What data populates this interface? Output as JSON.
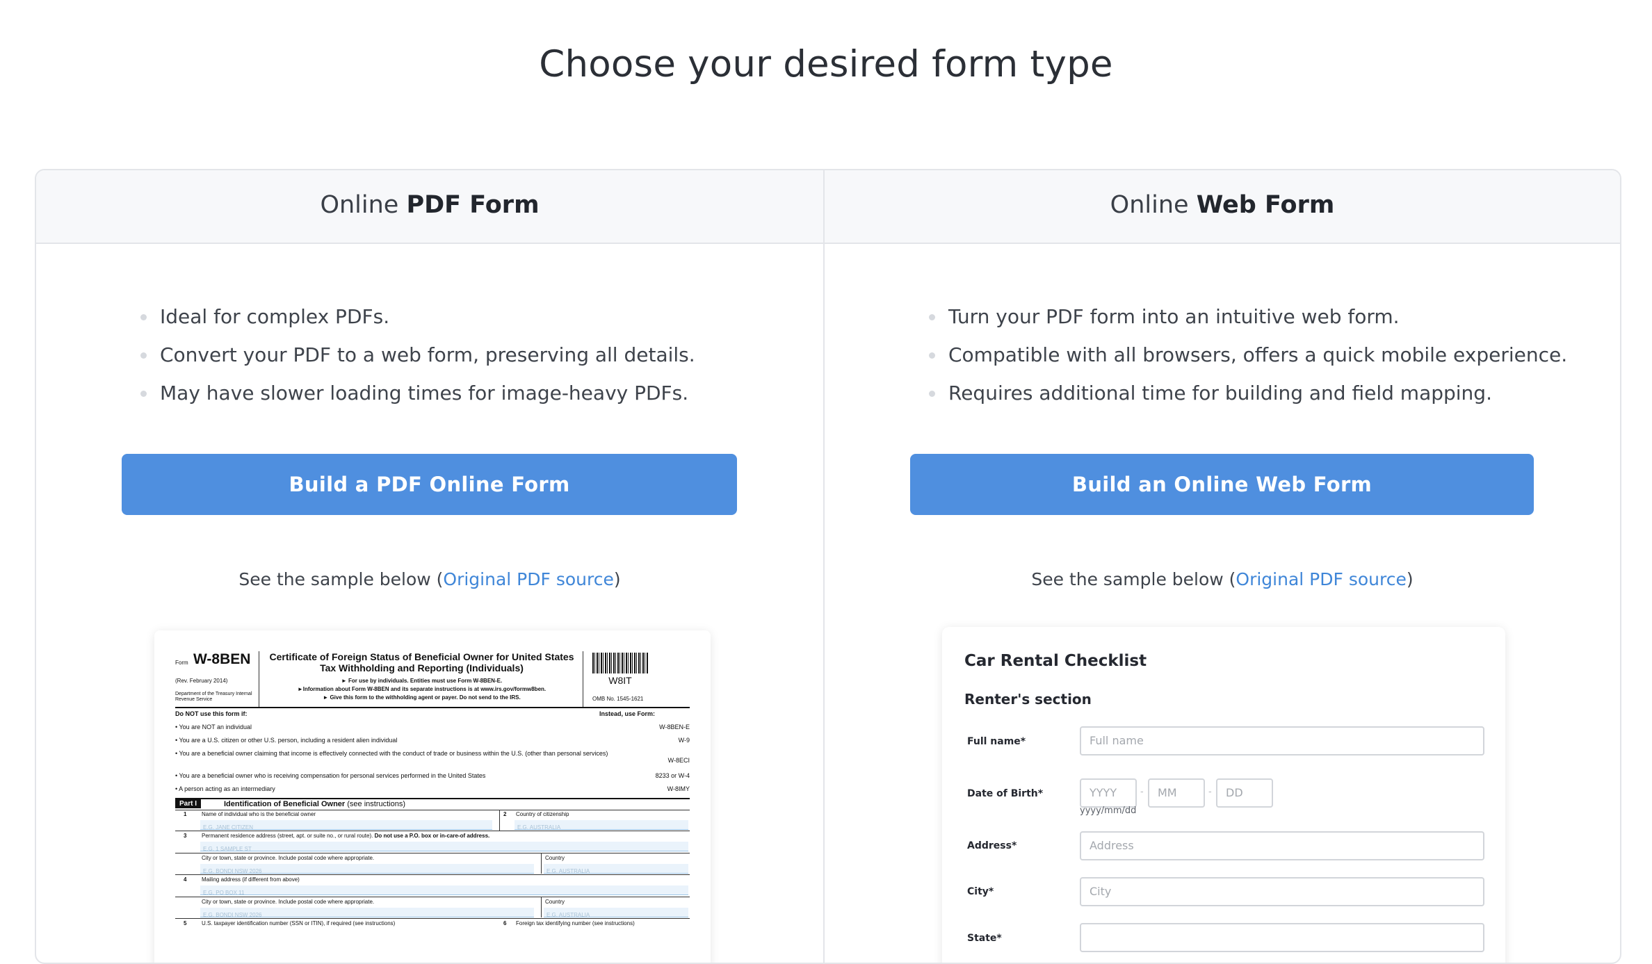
{
  "page": {
    "heading": "Choose your desired form type"
  },
  "columns": {
    "pdf": {
      "title_prefix": "Online ",
      "title_bold": "PDF Form",
      "bullets": [
        "Ideal for complex PDFs.",
        "Convert your PDF to a web form, preserving all details.",
        "May have slower loading times for image-heavy PDFs."
      ],
      "button_label": "Build a PDF Online Form",
      "sample_prefix": "See the sample below (",
      "sample_link": "Original PDF source",
      "sample_suffix": ")"
    },
    "web": {
      "title_prefix": "Online ",
      "title_bold": "Web Form",
      "bullets": [
        "Turn your PDF form into an intuitive web form.",
        "Compatible with all browsers, offers a quick mobile experience.",
        "Requires additional time for building and field mapping."
      ],
      "button_label": "Build an Online Web Form",
      "sample_prefix": "See the sample below (",
      "sample_link": "Original PDF source",
      "sample_suffix": ")"
    }
  },
  "pdf_preview": {
    "form_label": "Form",
    "form_id": "W-8BEN",
    "rev": "(Rev. February 2014)",
    "dept": "Department of the Treasury Internal Revenue Service",
    "title": "Certificate of Foreign Status of Beneficial Owner for United States Tax Withholding and Reporting (Individuals)",
    "line1": "► For use by individuals. Entities must use Form W-8BEN-E.",
    "line2": "►Information about Form W-8BEN and its separate instructions is at www.irs.gov/formw8ben.",
    "line3": "► Give this form to the withholding agent or payer. Do not send to the IRS.",
    "barcode_text": "W8IT",
    "omb": "OMB No. 1545-1621",
    "do_not_use": "Do NOT use this form if:",
    "instead": "Instead, use Form:",
    "rows": [
      {
        "text": "• You are NOT an individual",
        "form": "W-8BEN-E"
      },
      {
        "text": "• You are a U.S. citizen or other U.S. person, including a resident alien individual",
        "form": "W-9"
      },
      {
        "text": "• You are a beneficial owner claiming that income is effectively connected with the conduct of trade or business within the U.S. (other than personal services)",
        "form": "W-8ECI"
      },
      {
        "text": "• You are a beneficial owner who is receiving compensation for personal services performed in the United States",
        "form": "8233 or W-4"
      },
      {
        "text": "• A person acting as an intermediary",
        "form": "W-8IMY"
      }
    ],
    "part_label": "Part I",
    "part_title": "Identification of Beneficial Owner",
    "part_note": "(see instructions)",
    "fields": {
      "f1_label": "Name of individual who is the beneficial owner",
      "f1_placeholder": "E.G. JANE CITIZEN",
      "f2_label": "Country of citizenship",
      "f2_placeholder": "E.G. AUSTRALIA",
      "f3_label": "Permanent residence address (street, apt. or suite no., or rural route).",
      "f3_bold": "Do not use a P.O. box or in-care-of address.",
      "f3_placeholder": "E.G. 1 SAMPLE ST",
      "city_label": "City or town, state or province. Include postal code where appropriate.",
      "city_placeholder": "E.G. BONDI NSW 2026",
      "country_label": "Country",
      "country_placeholder": "E.G. AUSTRALIA",
      "f4_label": "Mailing address (if different from above)",
      "f4_placeholder": "E.G. PO BOX 11",
      "city2_label": "City or town, state or province. Include postal code where appropriate.",
      "city2_placeholder": "E.G. BONDI NSW 2026",
      "country2_label": "Country",
      "country2_placeholder": "E.G. AUSTRALIA",
      "f5_label": "U.S. taxpayer identification number (SSN or ITIN), if required (see instructions)",
      "f6_label": "Foreign tax identifying number (see instructions)",
      "num1": "1",
      "num2": "2",
      "num3": "3",
      "num4": "4",
      "num5": "5",
      "num6": "6"
    }
  },
  "web_preview": {
    "title": "Car Rental Checklist",
    "section": "Renter's section",
    "full_name_label": "Full name*",
    "full_name_placeholder": "Full name",
    "dob_label": "Date of Birth*",
    "dob_yyyy": "YYYY",
    "dob_mm": "MM",
    "dob_dd": "DD",
    "dob_sep": "-",
    "dob_hint": "yyyy/mm/dd",
    "address_label": "Address*",
    "address_placeholder": "Address",
    "city_label": "City*",
    "city_placeholder": "City",
    "state_label": "State*"
  }
}
